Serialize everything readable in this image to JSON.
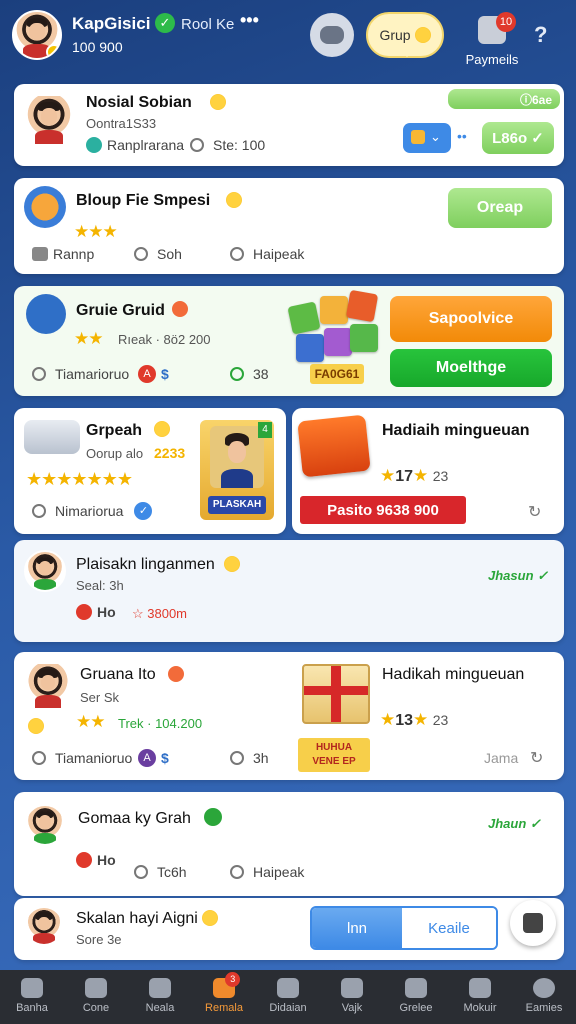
{
  "header": {
    "name": "KapGisici",
    "role": "Rool Ke",
    "more": "•••",
    "sub": "100 900",
    "grup_label": "Grup",
    "payments_label": "Paymeils",
    "payments_badge": "10",
    "help": "?"
  },
  "card1": {
    "title": "Nosial Sobian",
    "sub": "Oontra1S33",
    "meta1": "Ranplrarana",
    "meta2": "Ste: 100",
    "pill_top": "ⓘ6ae",
    "btn_label": "L86o",
    "dots": "••"
  },
  "card2": {
    "title": "Bloup Fie Smpesi",
    "stars": "★★★",
    "btn_label": "Oreap",
    "a1": "Rannp",
    "a2": "Soh",
    "a3": "Haipeak"
  },
  "card3": {
    "title": "Gruie Gruid",
    "stars": "★★",
    "sub": "Rıeak · 8ö2 200",
    "m1": "Tiamarioruo",
    "m2": "A",
    "m3": "$",
    "m4": "38",
    "tag": "FA0G61",
    "btn1": "Sapoolvice",
    "btn2": "Moelthge"
  },
  "card4": {
    "title": "Grpeah",
    "sub": "Oorup alo",
    "sub_num": "2233",
    "stars": "★★★★★★★",
    "meta": "Nimariorua",
    "portrait_label": "PLASKAH",
    "portrait_badge": "4"
  },
  "card5": {
    "title": "Hadiaih mingueuan",
    "rating": "17",
    "rating_stars": "★★",
    "rating_count": "23",
    "bar": "Pasito 9638 900",
    "share": "↻"
  },
  "card6": {
    "title": "Plaisakn linganmen",
    "sub": "Seal: 3h",
    "item1": "Ho",
    "item2": "☆ 3800m",
    "status": "Jhasun ✓"
  },
  "card7": {
    "title": "Gruana Ito",
    "sub": "Ser Sk",
    "stars": "★★",
    "sub2": "Trek · 104.200",
    "m1": "Tiamanioruo",
    "m2": "A",
    "m3": "$",
    "m4": "3h"
  },
  "card8": {
    "title": "Hadikah mingueuan",
    "rating": "13",
    "rating_count": "23",
    "tag_line1": "HUHUA",
    "tag_line2": "VENE EP",
    "status": "Jama"
  },
  "card9": {
    "title": "Gomaa ky Grah",
    "item1": "Ho",
    "item2": "Tc6h",
    "item3": "Haipeak",
    "status": "Jhaun ✓"
  },
  "card10": {
    "title": "Skalan hayi Aigni",
    "sub": "Sore 3e",
    "seg1": "lnn",
    "seg2": "Keaile"
  },
  "nav": [
    {
      "label": "Banha"
    },
    {
      "label": "Cone"
    },
    {
      "label": "Neala"
    },
    {
      "label": "Remala",
      "badge": "3"
    },
    {
      "label": "Didaian"
    },
    {
      "label": "Vajk"
    },
    {
      "label": "Grelee"
    },
    {
      "label": "Mokuir"
    },
    {
      "label": "Eamies"
    }
  ],
  "colors": {
    "background": "#2a5aa6",
    "accent_orange": "#f28a08",
    "accent_green": "#17a82b",
    "nav_bg": "#2a2d33"
  }
}
